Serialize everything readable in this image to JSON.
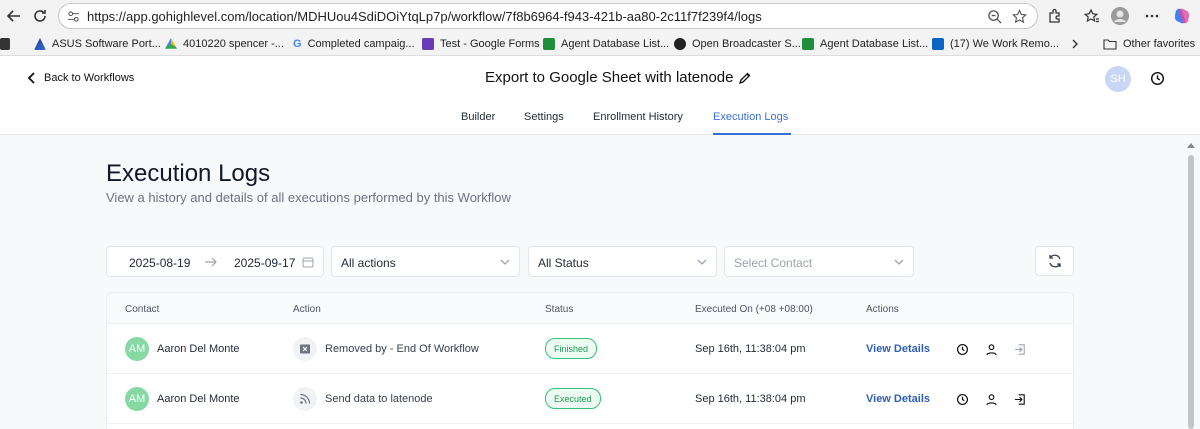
{
  "browser": {
    "url": "https://app.gohighlevel.com/location/MDHUou4SdiDOiYtqLp7p/workflow/7f8b6964-f943-421b-aa80-2c11f7f239f4/logs",
    "bookmarks": [
      {
        "label": "ASUS Software Port...",
        "icon": "asus-icon"
      },
      {
        "label": "4010220 spencer -...",
        "icon": "google-drive-icon"
      },
      {
        "label": "Completed campaig...",
        "icon": "google-icon"
      },
      {
        "label": "Test - Google Forms",
        "icon": "google-forms-icon"
      },
      {
        "label": "Agent Database List...",
        "icon": "google-sheets-icon"
      },
      {
        "label": "Open Broadcaster S...",
        "icon": "obs-icon"
      },
      {
        "label": "Agent Database List...",
        "icon": "google-sheets-icon"
      },
      {
        "label": "(17) We Work Remo...",
        "icon": "linkedin-icon"
      }
    ],
    "other_favorites": "Other favorites"
  },
  "header": {
    "back_label": "Back to Workflows",
    "title": "Export to Google Sheet with latenode",
    "avatar_initials": "SH"
  },
  "tabs": [
    "Builder",
    "Settings",
    "Enrollment History",
    "Execution Logs"
  ],
  "active_tab": "Execution Logs",
  "page": {
    "title": "Execution Logs",
    "subtitle": "View a history and details of all executions performed by this Workflow"
  },
  "filters": {
    "date_from": "2025-08-19",
    "date_to": "2025-09-17",
    "actions": "All actions",
    "status": "All Status",
    "contact_placeholder": "Select Contact"
  },
  "table": {
    "columns": [
      "Contact",
      "Action",
      "Status",
      "Executed On (+08 +08:00)",
      "Actions"
    ],
    "rows": [
      {
        "initials": "AM",
        "contact": "Aaron Del Monte",
        "action": "Removed by - End Of Workflow",
        "action_icon": "exit-workflow-icon",
        "status": "Finished",
        "executed_on": "Sep 16th, 11:38:04 pm",
        "link": "View Details"
      },
      {
        "initials": "AM",
        "contact": "Aaron Del Monte",
        "action": "Send data to latenode",
        "action_icon": "webhook-icon",
        "status": "Executed",
        "executed_on": "Sep 16th, 11:38:04 pm",
        "link": "View Details"
      }
    ]
  },
  "colors": {
    "accent": "#3b6fd8",
    "status_green": "#1f9d57",
    "avatar_green": "#86d9a3"
  }
}
